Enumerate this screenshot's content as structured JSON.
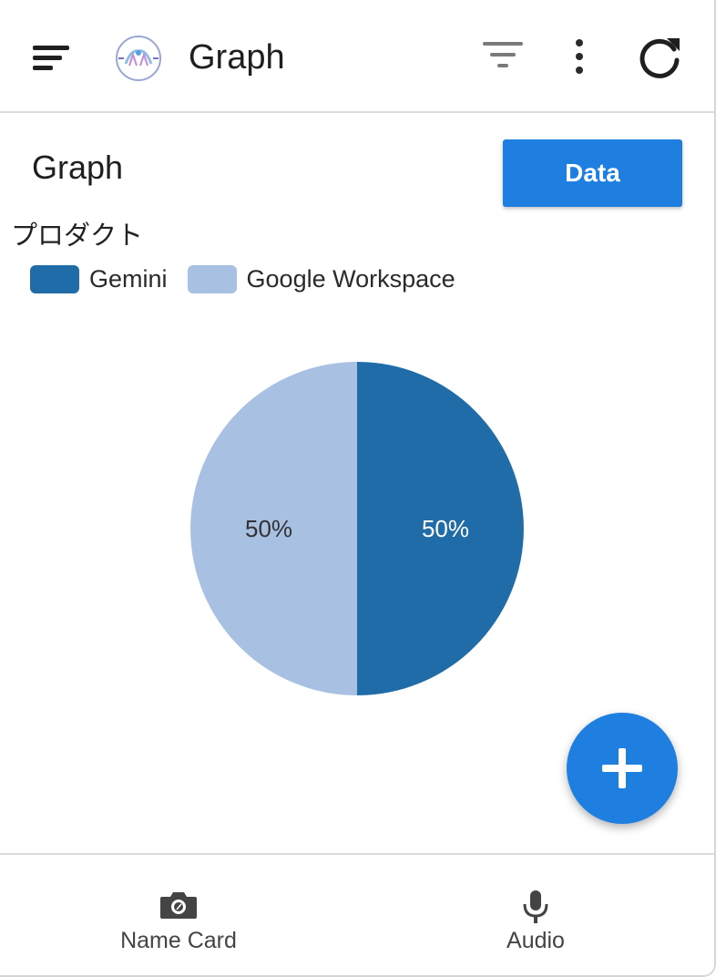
{
  "header": {
    "title": "Graph",
    "menu_icon": "menu-icon",
    "filter_icon": "filter-icon",
    "more_icon": "more-vert-icon",
    "refresh_icon": "refresh-icon"
  },
  "content": {
    "title": "Graph",
    "data_button_label": "Data"
  },
  "chart_data": {
    "type": "pie",
    "legend_title": "プロダクト",
    "legend_position": "top-left",
    "categories": [
      "Gemini",
      "Google Workspace"
    ],
    "values": [
      50,
      50
    ],
    "labels": [
      "50%",
      "50%"
    ],
    "colors": [
      "#1f6ca8",
      "#a8c1e3"
    ],
    "label_colors": [
      "#ffffff",
      "#333333"
    ]
  },
  "fab": {
    "icon": "plus-icon"
  },
  "bottom_nav": {
    "items": [
      {
        "label": "Name Card",
        "icon": "camera-icon"
      },
      {
        "label": "Audio",
        "icon": "microphone-icon"
      }
    ]
  },
  "colors": {
    "accent": "#1e7fe0",
    "text": "#1f1f1f",
    "divider": "#dcdcdc"
  }
}
